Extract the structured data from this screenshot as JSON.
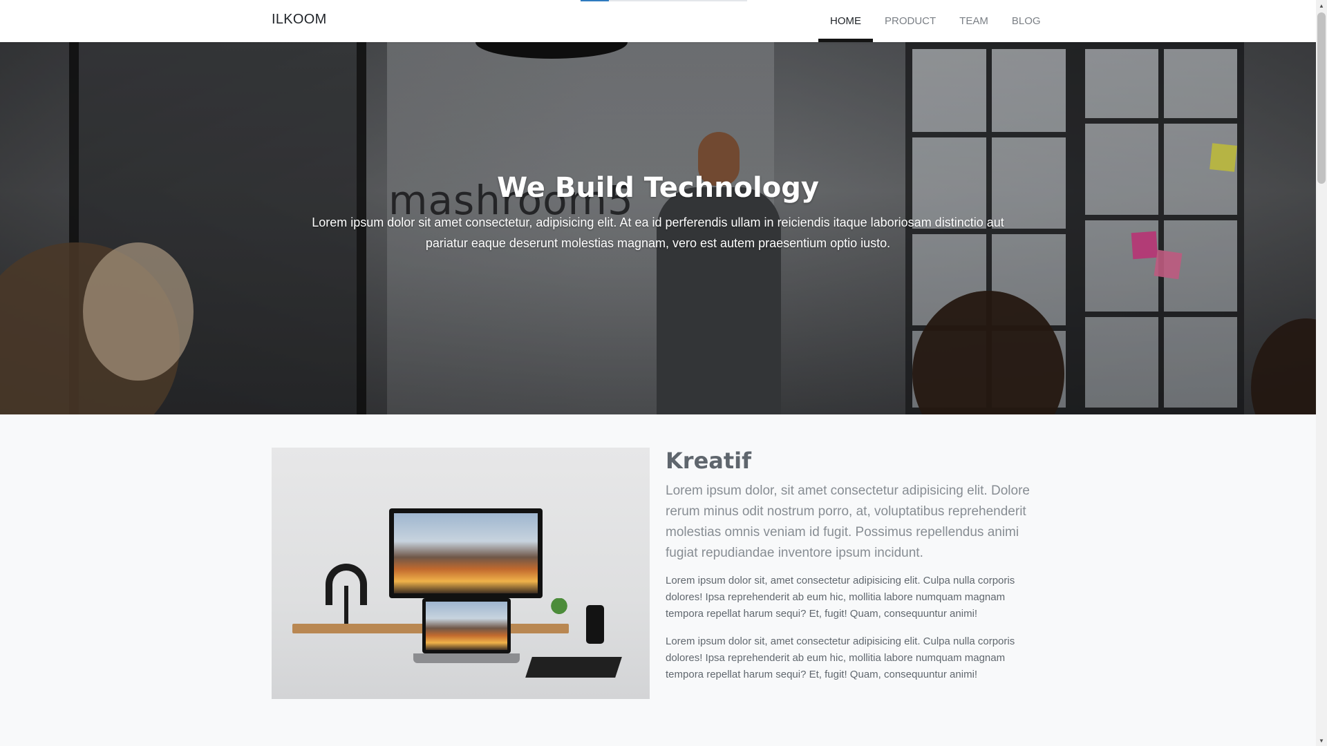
{
  "page": {
    "loading_progress": 0.17
  },
  "navbar": {
    "brand": "ILKOOM",
    "links": [
      {
        "label": "HOME",
        "active": true
      },
      {
        "label": "PRODUCT",
        "active": false
      },
      {
        "label": "TEAM",
        "active": false
      },
      {
        "label": "BLOG",
        "active": false
      }
    ]
  },
  "hero": {
    "title": "We Build Technology",
    "lead": "Lorem ipsum dolor sit amet consectetur, adipisicing elit. At ea id perferendis ullam in reiciendis itaque laboriosam distinctio aut pariatur eaque deserunt molestias magnam, vero est autem praesentium optio iusto.",
    "background_image_sign_text": "mashroom5"
  },
  "feature": {
    "title": "Kreatif",
    "lead": "Lorem ipsum dolor, sit amet consectetur adipisicing elit. Dolore rerum minus odit nostrum porro, at, voluptatibus reprehenderit molestias omnis veniam id fugit. Possimus repellendus animi fugiat repudiandae inventore ipsum incidunt.",
    "paragraphs": [
      "Lorem ipsum dolor sit, amet consectetur adipisicing elit. Culpa nulla corporis dolores! Ipsa reprehenderit ab eum hic, mollitia labore numquam magnam tempora repellat harum sequi? Et, fugit! Quam, consequuntur animi!",
      "Lorem ipsum dolor sit, amet consectetur adipisicing elit. Culpa nulla corporis dolores! Ipsa reprehenderit ab eum hic, mollitia labore numquam magnam tempora repellat harum sequi? Et, fugit! Quam, consequuntur animi!"
    ]
  },
  "scrollbar": {
    "up_icon": "triangle-up-icon",
    "down_icon": "triangle-down-icon"
  },
  "colors": {
    "navbar_bg": "#ffffff",
    "active_indicator": "#141414",
    "page_bg": "#f8f9fa",
    "loading_bar": "#2f7bbf"
  }
}
